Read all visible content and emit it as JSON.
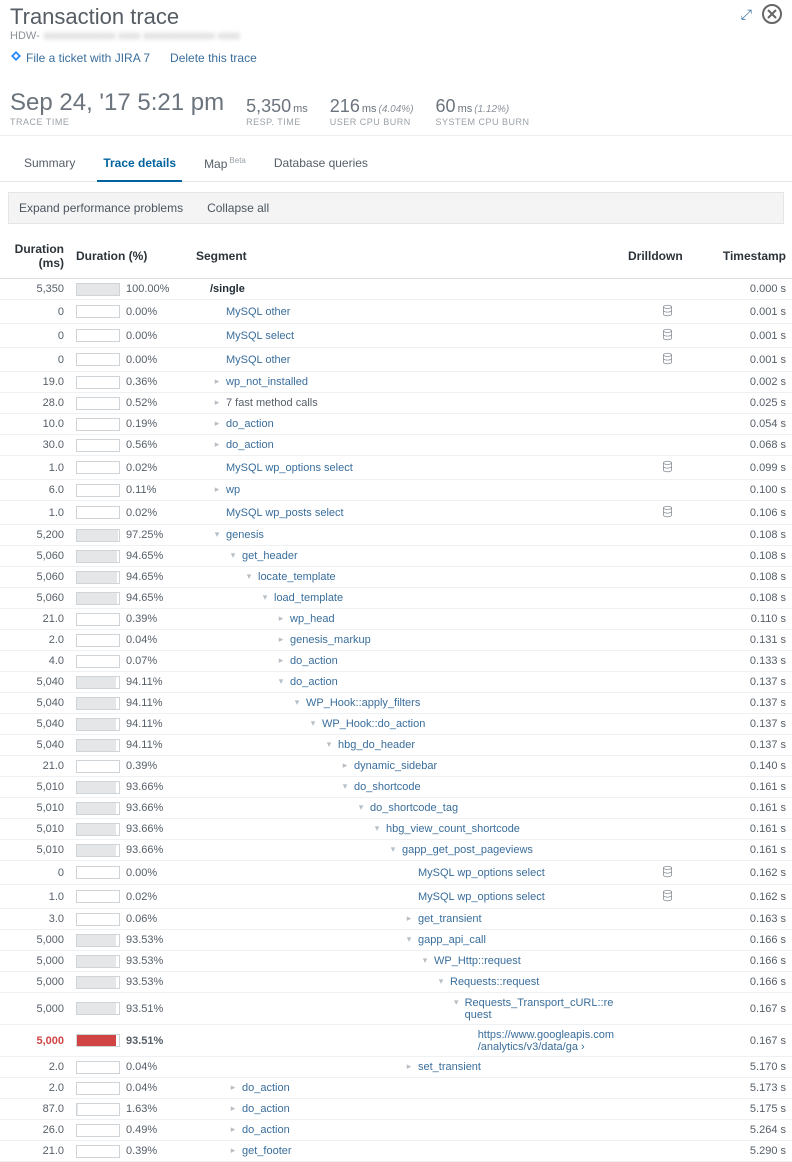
{
  "header": {
    "title": "Transaction trace",
    "subtitle_prefix": "HDW-",
    "subtitle_blur": "xxxxxxxxxxxxx xxxx xxxxxxxxxxxxx xxxx",
    "jira_label": "File a ticket with JIRA 7",
    "delete_label": "Delete this trace"
  },
  "metrics": {
    "trace_time": {
      "value": "Sep 24, '17 5:21 pm",
      "label": "TRACE TIME"
    },
    "resp_time": {
      "value": "5,350",
      "unit": "ms",
      "label": "RESP. TIME"
    },
    "user_cpu": {
      "value": "216",
      "unit": "ms",
      "pct": "(4.04%)",
      "label": "USER CPU BURN"
    },
    "sys_cpu": {
      "value": "60",
      "unit": "ms",
      "pct": "(1.12%)",
      "label": "SYSTEM CPU BURN"
    }
  },
  "tabs": {
    "summary": "Summary",
    "details": "Trace details",
    "map": "Map",
    "map_badge": "Beta",
    "db": "Database queries"
  },
  "toolbar": {
    "expand": "Expand performance problems",
    "collapse": "Collapse all"
  },
  "columns": {
    "duration": "Duration (ms)",
    "durpct": "Duration (%)",
    "segment": "Segment",
    "drilldown": "Drilldown",
    "timestamp": "Timestamp"
  },
  "rows": [
    {
      "dur": "5,350",
      "pct": "100.00%",
      "fill": 100,
      "indent": 0,
      "toggle": "",
      "seg": "/single",
      "bold": true,
      "drill": "",
      "ts": "0.000 s"
    },
    {
      "dur": "0",
      "pct": "0.00%",
      "fill": 0,
      "indent": 1,
      "toggle": "",
      "seg": "MySQL other",
      "drill": "db",
      "ts": "0.001 s"
    },
    {
      "dur": "0",
      "pct": "0.00%",
      "fill": 0,
      "indent": 1,
      "toggle": "",
      "seg": "MySQL select",
      "drill": "db",
      "ts": "0.001 s"
    },
    {
      "dur": "0",
      "pct": "0.00%",
      "fill": 0,
      "indent": 1,
      "toggle": "",
      "seg": "MySQL other",
      "drill": "db",
      "ts": "0.001 s"
    },
    {
      "dur": "19.0",
      "pct": "0.36%",
      "fill": 0,
      "indent": 1,
      "toggle": ">",
      "seg": "wp_not_installed",
      "drill": "",
      "ts": "0.002 s"
    },
    {
      "dur": "28.0",
      "pct": "0.52%",
      "fill": 0,
      "indent": 1,
      "toggle": ">",
      "seg": "7 fast method calls",
      "plain": true,
      "drill": "",
      "ts": "0.025 s"
    },
    {
      "dur": "10.0",
      "pct": "0.19%",
      "fill": 0,
      "indent": 1,
      "toggle": ">",
      "seg": "do_action",
      "drill": "",
      "ts": "0.054 s"
    },
    {
      "dur": "30.0",
      "pct": "0.56%",
      "fill": 0,
      "indent": 1,
      "toggle": ">",
      "seg": "do_action",
      "drill": "",
      "ts": "0.068 s"
    },
    {
      "dur": "1.0",
      "pct": "0.02%",
      "fill": 0,
      "indent": 1,
      "toggle": "",
      "seg": "MySQL wp_options select",
      "drill": "db",
      "ts": "0.099 s"
    },
    {
      "dur": "6.0",
      "pct": "0.11%",
      "fill": 0,
      "indent": 1,
      "toggle": ">",
      "seg": "wp",
      "drill": "",
      "ts": "0.100 s"
    },
    {
      "dur": "1.0",
      "pct": "0.02%",
      "fill": 0,
      "indent": 1,
      "toggle": "",
      "seg": "MySQL wp_posts select",
      "drill": "db",
      "ts": "0.106 s"
    },
    {
      "dur": "5,200",
      "pct": "97.25%",
      "fill": 97,
      "indent": 1,
      "toggle": "v",
      "seg": "genesis",
      "drill": "",
      "ts": "0.108 s"
    },
    {
      "dur": "5,060",
      "pct": "94.65%",
      "fill": 95,
      "indent": 2,
      "toggle": "v",
      "seg": "get_header",
      "drill": "",
      "ts": "0.108 s"
    },
    {
      "dur": "5,060",
      "pct": "94.65%",
      "fill": 95,
      "indent": 3,
      "toggle": "v",
      "seg": "locate_template",
      "drill": "",
      "ts": "0.108 s"
    },
    {
      "dur": "5,060",
      "pct": "94.65%",
      "fill": 95,
      "indent": 4,
      "toggle": "v",
      "seg": "load_template",
      "drill": "",
      "ts": "0.108 s"
    },
    {
      "dur": "21.0",
      "pct": "0.39%",
      "fill": 0,
      "indent": 5,
      "toggle": ">",
      "seg": "wp_head",
      "drill": "",
      "ts": "0.110 s"
    },
    {
      "dur": "2.0",
      "pct": "0.04%",
      "fill": 0,
      "indent": 5,
      "toggle": ">",
      "seg": "genesis_markup",
      "drill": "",
      "ts": "0.131 s"
    },
    {
      "dur": "4.0",
      "pct": "0.07%",
      "fill": 0,
      "indent": 5,
      "toggle": ">",
      "seg": "do_action",
      "drill": "",
      "ts": "0.133 s"
    },
    {
      "dur": "5,040",
      "pct": "94.11%",
      "fill": 94,
      "indent": 5,
      "toggle": "v",
      "seg": "do_action",
      "drill": "",
      "ts": "0.137 s"
    },
    {
      "dur": "5,040",
      "pct": "94.11%",
      "fill": 94,
      "indent": 6,
      "toggle": "v",
      "seg": "WP_Hook::apply_filters",
      "drill": "",
      "ts": "0.137 s"
    },
    {
      "dur": "5,040",
      "pct": "94.11%",
      "fill": 94,
      "indent": 7,
      "toggle": "v",
      "seg": "WP_Hook::do_action",
      "drill": "",
      "ts": "0.137 s"
    },
    {
      "dur": "5,040",
      "pct": "94.11%",
      "fill": 94,
      "indent": 8,
      "toggle": "v",
      "seg": "hbg_do_header",
      "drill": "",
      "ts": "0.137 s"
    },
    {
      "dur": "21.0",
      "pct": "0.39%",
      "fill": 0,
      "indent": 9,
      "toggle": ">",
      "seg": "dynamic_sidebar",
      "drill": "",
      "ts": "0.140 s"
    },
    {
      "dur": "5,010",
      "pct": "93.66%",
      "fill": 94,
      "indent": 9,
      "toggle": "v",
      "seg": "do_shortcode",
      "drill": "",
      "ts": "0.161 s"
    },
    {
      "dur": "5,010",
      "pct": "93.66%",
      "fill": 94,
      "indent": 10,
      "toggle": "v",
      "seg": "do_shortcode_tag",
      "drill": "",
      "ts": "0.161 s"
    },
    {
      "dur": "5,010",
      "pct": "93.66%",
      "fill": 94,
      "indent": 11,
      "toggle": "v",
      "seg": "hbg_view_count_shortcode",
      "drill": "",
      "ts": "0.161 s"
    },
    {
      "dur": "5,010",
      "pct": "93.66%",
      "fill": 94,
      "indent": 12,
      "toggle": "v",
      "seg": "gapp_get_post_pageviews",
      "drill": "",
      "ts": "0.161 s"
    },
    {
      "dur": "0",
      "pct": "0.00%",
      "fill": 0,
      "indent": 13,
      "toggle": "",
      "seg": "MySQL wp_options select",
      "drill": "db",
      "ts": "0.162 s"
    },
    {
      "dur": "1.0",
      "pct": "0.02%",
      "fill": 0,
      "indent": 13,
      "toggle": "",
      "seg": "MySQL wp_options select",
      "drill": "db",
      "ts": "0.162 s"
    },
    {
      "dur": "3.0",
      "pct": "0.06%",
      "fill": 0,
      "indent": 13,
      "toggle": ">",
      "seg": "get_transient",
      "drill": "",
      "ts": "0.163 s"
    },
    {
      "dur": "5,000",
      "pct": "93.53%",
      "fill": 94,
      "indent": 13,
      "toggle": "v",
      "seg": "gapp_api_call",
      "drill": "",
      "ts": "0.166 s"
    },
    {
      "dur": "5,000",
      "pct": "93.53%",
      "fill": 94,
      "indent": 14,
      "toggle": "v",
      "seg": "WP_Http::request",
      "drill": "",
      "ts": "0.166 s"
    },
    {
      "dur": "5,000",
      "pct": "93.53%",
      "fill": 94,
      "indent": 15,
      "toggle": "v",
      "seg": "Requests::request",
      "drill": "",
      "ts": "0.166 s"
    },
    {
      "dur": "5,000",
      "pct": "93.51%",
      "fill": 94,
      "indent": 16,
      "toggle": "v",
      "seg": "Requests_Transport_cURL::request",
      "drill": "",
      "ts": "0.167 s"
    },
    {
      "dur": "5,000",
      "pct": "93.51%",
      "fill": 94,
      "indent": 17,
      "toggle": "",
      "seg": "https://www.googleapis.com/analytics/v3/data/ga ›",
      "drill": "",
      "ts": "0.167 s",
      "hot": true,
      "boldpct": true
    },
    {
      "dur": "2.0",
      "pct": "0.04%",
      "fill": 0,
      "indent": 13,
      "toggle": ">",
      "seg": "set_transient",
      "drill": "",
      "ts": "5.170 s"
    },
    {
      "dur": "2.0",
      "pct": "0.04%",
      "fill": 0,
      "indent": 2,
      "toggle": ">",
      "seg": "do_action",
      "drill": "",
      "ts": "5.173 s"
    },
    {
      "dur": "87.0",
      "pct": "1.63%",
      "fill": 2,
      "indent": 2,
      "toggle": ">",
      "seg": "do_action",
      "drill": "",
      "ts": "5.175 s"
    },
    {
      "dur": "26.0",
      "pct": "0.49%",
      "fill": 0,
      "indent": 2,
      "toggle": ">",
      "seg": "do_action",
      "drill": "",
      "ts": "5.264 s"
    },
    {
      "dur": "21.0",
      "pct": "0.39%",
      "fill": 0,
      "indent": 2,
      "toggle": ">",
      "seg": "get_footer",
      "drill": "",
      "ts": "5.290 s"
    }
  ]
}
